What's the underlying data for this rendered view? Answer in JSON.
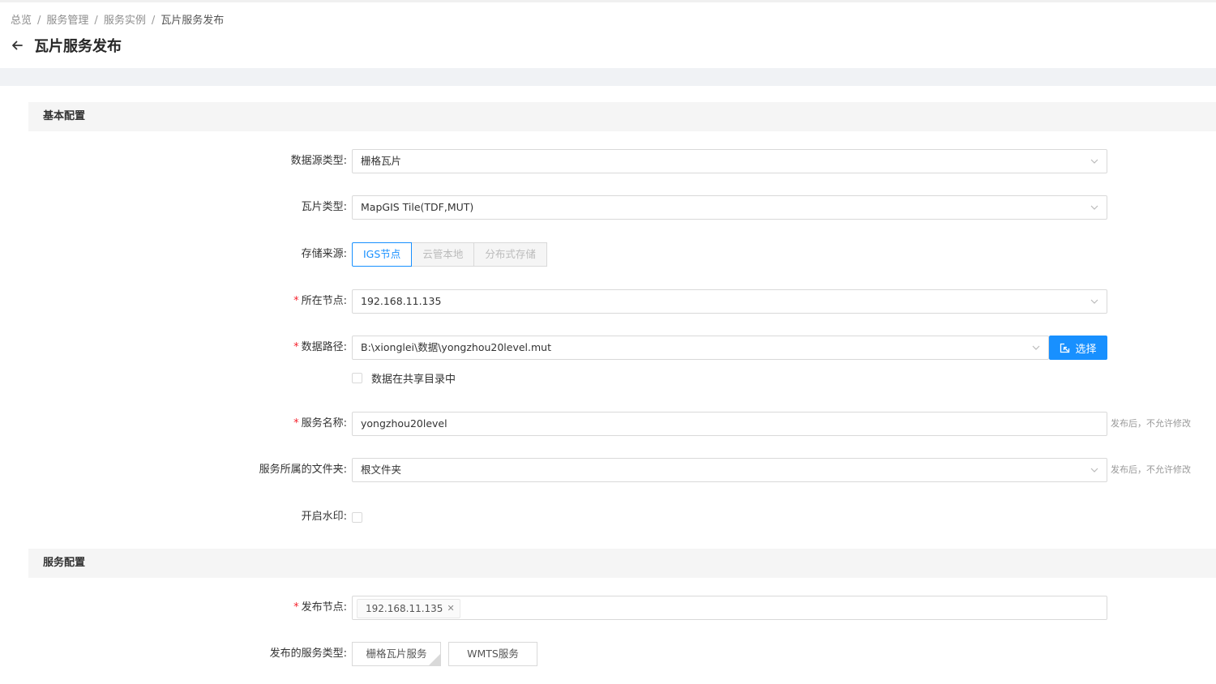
{
  "breadcrumb": {
    "home": "总览",
    "service_mgmt": "服务管理",
    "service_instance": "服务实例",
    "current": "瓦片服务发布"
  },
  "page": {
    "title": "瓦片服务发布"
  },
  "sections": {
    "basic": "基本配置",
    "service": "服务配置"
  },
  "form": {
    "source_type": {
      "label": "数据源类型:",
      "value": "栅格瓦片"
    },
    "tile_type": {
      "label": "瓦片类型:",
      "value": "MapGIS Tile(TDF,MUT)"
    },
    "storage": {
      "label": "存储来源:",
      "options": [
        "IGS节点",
        "云管本地",
        "分布式存储"
      ],
      "selected": "IGS节点"
    },
    "node": {
      "label": "所在节点:",
      "value": "192.168.11.135"
    },
    "data_path": {
      "label": "数据路径:",
      "value": "B:\\xionglei\\数据\\yongzhou20level.mut",
      "button": "选择"
    },
    "shared_dir": {
      "label": "数据在共享目录中",
      "checked": false
    },
    "service_name": {
      "label": "服务名称:",
      "value": "yongzhou20level",
      "hint": "发布后，不允许修改"
    },
    "folder": {
      "label": "服务所属的文件夹:",
      "value": "根文件夹",
      "hint": "发布后，不允许修改"
    },
    "watermark": {
      "label": "开启水印:",
      "checked": false
    },
    "publish_node": {
      "label": "发布节点:",
      "tags": [
        "192.168.11.135"
      ]
    },
    "publish_types": {
      "label": "发布的服务类型:",
      "options": [
        "栅格瓦片服务",
        "WMTS服务"
      ]
    }
  },
  "colors": {
    "primary": "#1890ff",
    "required": "#f5222d"
  },
  "icons": {
    "back": "arrow-left-icon",
    "chevron": "chevron-down-icon",
    "select": "select-icon",
    "remove": "close-icon"
  }
}
